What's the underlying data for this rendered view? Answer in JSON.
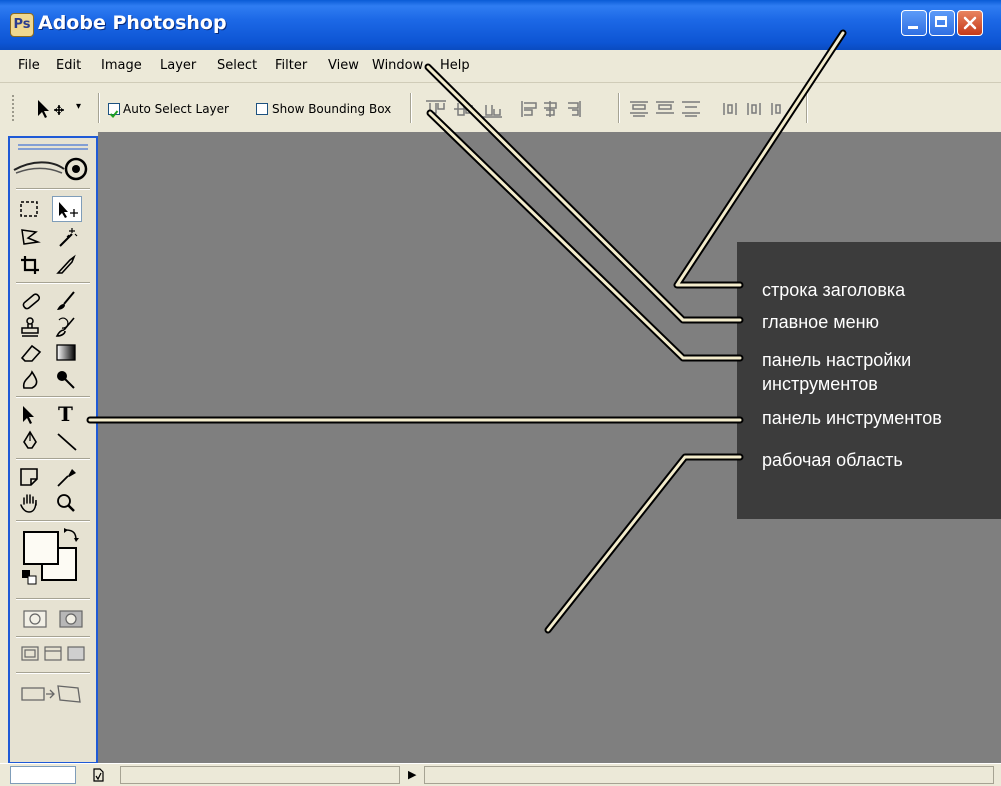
{
  "window": {
    "title": "Adobe Photoshop",
    "app_icon_glyph": "Ps"
  },
  "menu": [
    "File",
    "Edit",
    "Image",
    "Layer",
    "Select",
    "Filter",
    "View",
    "Window",
    "Help"
  ],
  "options_bar": {
    "tool_dropdown": "▾",
    "auto_select_layer": {
      "label": "Auto Select Layer",
      "checked": true
    },
    "show_bounding_box": {
      "label": "Show Bounding Box",
      "checked": false
    }
  },
  "tools": {
    "icon_names": [
      "marquee-icon",
      "move-icon",
      "lasso-icon",
      "magic-wand-icon",
      "crop-icon",
      "slice-icon",
      "healing-brush-icon",
      "brush-icon",
      "clone-stamp-icon",
      "history-brush-icon",
      "eraser-icon",
      "gradient-icon",
      "blur-icon",
      "dodge-icon",
      "path-select-icon",
      "type-icon",
      "pen-icon",
      "line-icon",
      "notes-icon",
      "eyedropper-icon",
      "hand-icon",
      "zoom-icon"
    ],
    "type_tool_glyph": "T"
  },
  "status_bar": {
    "arrow": "▶"
  },
  "callouts": [
    {
      "label": "строка заголовка"
    },
    {
      "label": "главное меню"
    },
    {
      "label": "панель настройки\nинструментов",
      "line1": "панель настройки",
      "line2": "инструментов"
    },
    {
      "label": "панель инструментов"
    },
    {
      "label": "рабочая область"
    }
  ],
  "colors": {
    "titlebar": "#0d55d4",
    "workarea": "#7f7f7f",
    "callout_box": "#3c3c3c",
    "callout_text": "#ffffff"
  }
}
